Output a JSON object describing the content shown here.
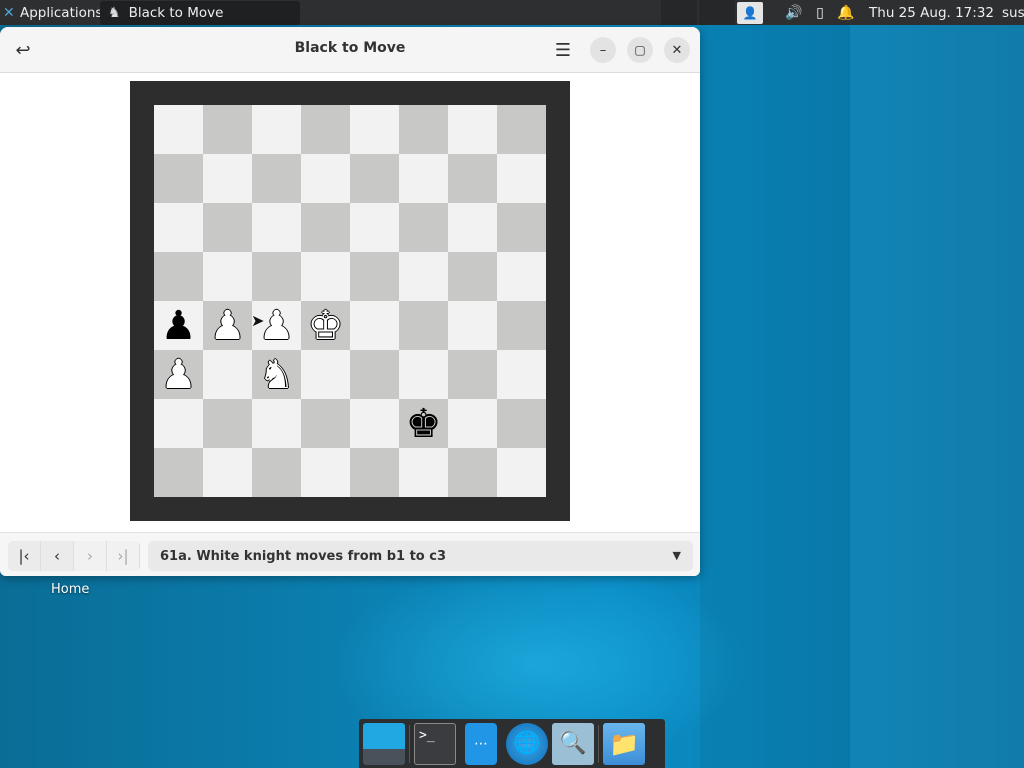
{
  "panel": {
    "applications_label": "Applications",
    "task_title": "Black to Move",
    "clock": "Thu 25 Aug. 17:32",
    "user": "sus"
  },
  "window": {
    "title": "Black to Move",
    "board": [
      [
        "",
        "",
        "",
        "",
        "",
        "",
        "",
        ""
      ],
      [
        "",
        "",
        "",
        "",
        "",
        "",
        "",
        ""
      ],
      [
        "",
        "",
        "",
        "",
        "",
        "",
        "",
        ""
      ],
      [
        "",
        "",
        "",
        "",
        "",
        "",
        "",
        ""
      ],
      [
        "bP",
        "wP",
        "wP",
        "wK",
        "",
        "",
        "",
        ""
      ],
      [
        "wP",
        "",
        "wN",
        "",
        "",
        "",
        "",
        ""
      ],
      [
        "",
        "",
        "",
        "",
        "",
        "bK",
        "",
        ""
      ],
      [
        "",
        "",
        "",
        "",
        "",
        "",
        "",
        ""
      ]
    ],
    "move_text": "61a. White knight moves from b1 to c3"
  },
  "desktop": {
    "home_label": "Home"
  },
  "icons": {
    "back": "undo-arrow-icon",
    "menu": "hamburger-icon",
    "minimize": "minimize-icon",
    "maximize": "maximize-icon",
    "close": "close-icon",
    "first": "first-move-icon",
    "prev": "previous-move-icon",
    "next": "next-move-icon",
    "last": "last-move-icon",
    "dropdown": "chevron-down-icon"
  },
  "colors": {
    "desktop_bg": "#0a7fb5",
    "board_frame": "#2d2d2e",
    "light_square": "#f2f2f2",
    "dark_square": "#c8c8c6"
  }
}
